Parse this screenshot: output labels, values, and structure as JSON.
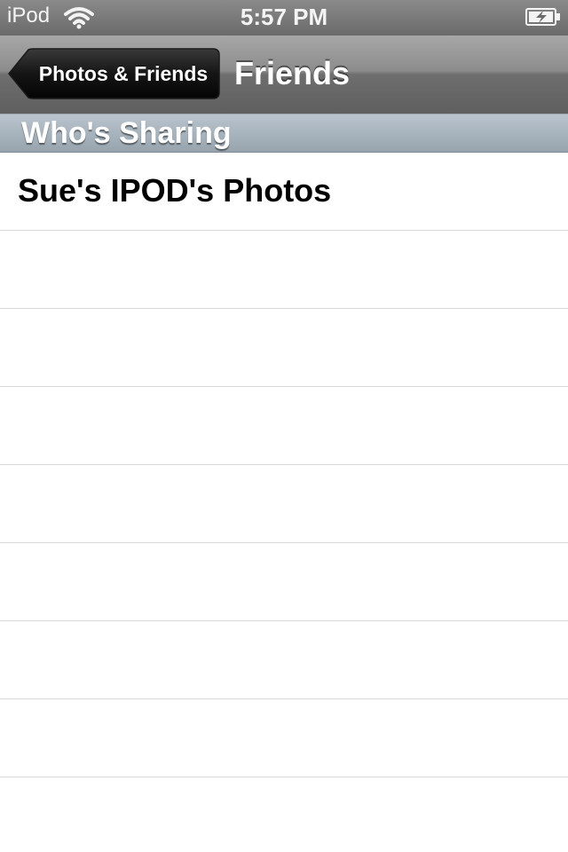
{
  "status_bar": {
    "carrier": "iPod",
    "time": "5:57 PM",
    "wifi_icon": "wifi-icon",
    "battery_icon": "battery-charging-icon"
  },
  "nav_bar": {
    "back_label": "Photos & Friends",
    "title": "Friends"
  },
  "section": {
    "title": "Who's Sharing"
  },
  "list": {
    "items": [
      {
        "label": "Sue's IPOD's Photos"
      },
      {
        "label": ""
      },
      {
        "label": ""
      },
      {
        "label": ""
      },
      {
        "label": ""
      },
      {
        "label": ""
      },
      {
        "label": ""
      },
      {
        "label": ""
      },
      {
        "label": ""
      }
    ]
  },
  "colors": {
    "status_bar": "#777777",
    "nav_bar": "#6e6e6e",
    "back_button": "#111111",
    "section_header": "#a8b4bd",
    "separator": "#d9d9d9"
  }
}
